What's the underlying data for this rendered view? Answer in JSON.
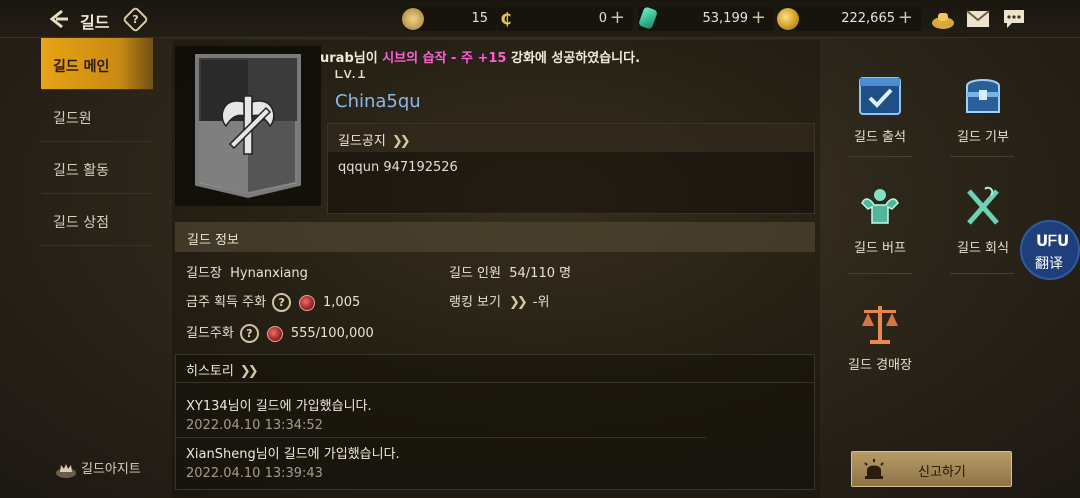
{
  "topbar": {
    "title": "길드",
    "help": "?",
    "resources": [
      {
        "name": "arrow-points",
        "value": "15",
        "plus": false
      },
      {
        "name": "c-currency",
        "value": "0",
        "plus": true
      },
      {
        "name": "diamond",
        "value": "53,199",
        "plus": true
      },
      {
        "name": "gold",
        "value": "222,665",
        "plus": true
      }
    ]
  },
  "nav": {
    "items": [
      "길드 메인",
      "길드원",
      "길드 활동",
      "길드 상점"
    ],
    "active_index": 0,
    "bottom_label": "길드아지트"
  },
  "banner": {
    "prefix": "urab님이 ",
    "highlight": "시브의 습작 - 주 +15",
    "suffix": " 강화에 성공하였습니다."
  },
  "guild": {
    "level": "Lv.1",
    "name": "China5qu",
    "notice_title": "길드공지",
    "notice_text": "qqqun 947192526"
  },
  "info": {
    "header": "길드 정보",
    "leader_label": "길드장",
    "leader_value": "Hynanxiang",
    "members_label": "길드 인원",
    "members_value": "54/110 명",
    "weekly_label": "금주 획득 주화",
    "weekly_value": "1,005",
    "ranking_label": "랭킹 보기",
    "ranking_value": "-위",
    "coin_label": "길드주화",
    "coin_value": "555/100,000"
  },
  "history": {
    "header": "히스토리",
    "entries": [
      {
        "message": "XY134님이 길드에 가입했습니다.",
        "time": "2022.04.10 13:34:52"
      },
      {
        "message": "XianSheng님이 길드에 가입했습니다.",
        "time": "2022.04.10 13:39:43"
      }
    ]
  },
  "right_menu": {
    "attendance": "길드 출석",
    "donation": "길드 기부",
    "buff": "길드 버프",
    "dinner": "길드 회식",
    "auction": "길드 경매장",
    "report": "신고하기"
  },
  "translate": {
    "brand": "ᑌᖴᑌ",
    "label": "翻译"
  },
  "colors": {
    "accent": "#e8a316",
    "guild_name": "#8bb9e8",
    "highlight": "#ff5fd6"
  }
}
